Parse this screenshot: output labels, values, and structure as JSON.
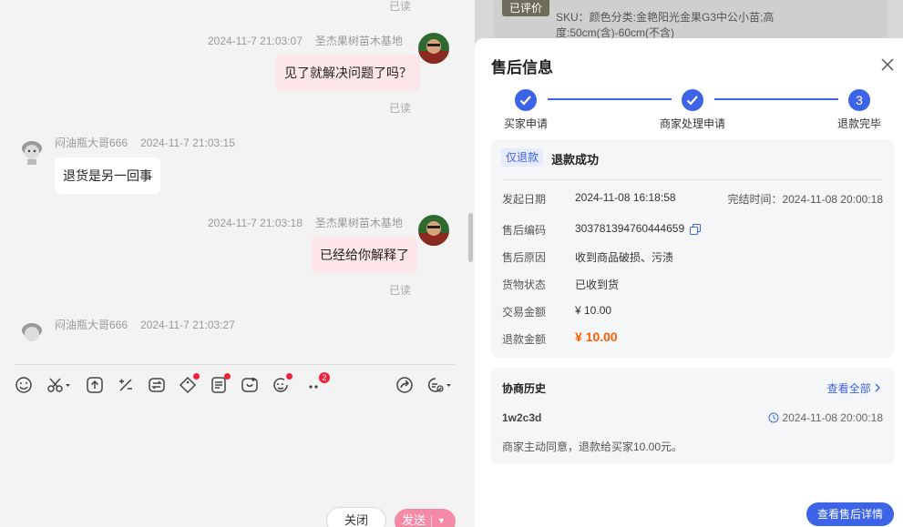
{
  "chat": {
    "messages": [
      {
        "read": "已读"
      },
      {
        "time": "2024-11-7 21:03:07",
        "sender": "圣杰果树苗木基地",
        "text": "见了就解决问题了吗？",
        "read": "已读"
      },
      {
        "sender": "闷油瓶大哥666",
        "time": "2024-11-7 21:03:15",
        "text": "退货是另一回事"
      },
      {
        "time": "2024-11-7 21:03:18",
        "sender": "圣杰果树苗木基地",
        "text": "已经给你解释了",
        "read": "已读"
      },
      {
        "sender": "闷油瓶大哥666",
        "time": "2024-11-7 21:03:27"
      }
    ],
    "toolbar": {
      "more_badge": "2"
    },
    "close_label": "关闭",
    "send_label": "发送",
    "send_caret": "▼"
  },
  "product": {
    "rated_tag": "已评价",
    "sku": "SKU：颜色分类:金艳阳光金果G3中公小苗;高度:50cm(含)-60cm(不含)"
  },
  "after_sale": {
    "title": "售后信息",
    "steps": [
      "买家申请",
      "商家处理申请",
      "退款完毕"
    ],
    "step3_number": "3",
    "type_tag": "仅退款",
    "status": "退款成功",
    "start_label": "发起日期",
    "start_value": "2024-11-08 16:18:58",
    "finish_text": "完结时间：2024-11-08 20:00:18",
    "id_label": "售后编码",
    "id_value": "303781394760444659",
    "reason_label": "售后原因",
    "reason_value": "收到商品破损、污渍",
    "goods_label": "货物状态",
    "goods_value": "已收到货",
    "amount_label": "交易金额",
    "amount_value": "¥ 10.00",
    "refund_label": "退款金额",
    "refund_value": "¥ 10.00",
    "history_title": "协商历史",
    "view_all": "查看全部",
    "history_user": "1w2c3d",
    "history_time": "2024-11-08 20:00:18",
    "history_msg": "商家主动同意，退款给买家10.00元。",
    "detail_button": "查看售后详情"
  }
}
